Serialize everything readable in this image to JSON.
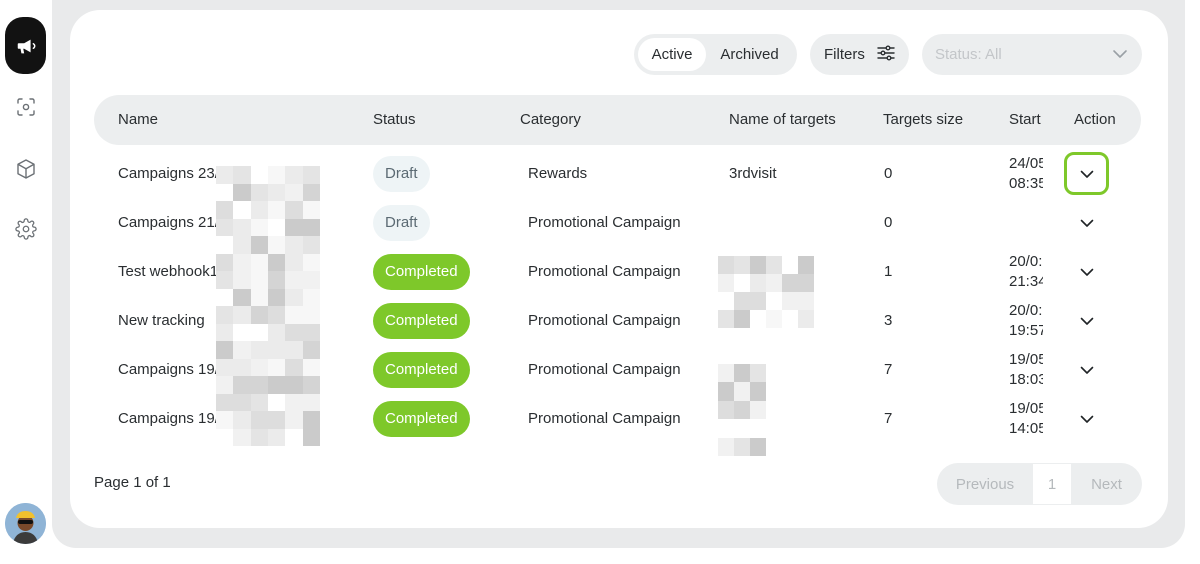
{
  "sidebar": {
    "items": [
      {
        "icon": "megaphone-icon",
        "active": true
      },
      {
        "icon": "scan-icon",
        "active": false
      },
      {
        "icon": "box-icon",
        "active": false
      },
      {
        "icon": "gear-icon",
        "active": false
      }
    ]
  },
  "toolbar": {
    "tab_active": "Active",
    "tab_archived": "Archived",
    "filters_label": "Filters",
    "status_placeholder": "Status: All"
  },
  "table": {
    "headers": {
      "name": "Name",
      "status": "Status",
      "category": "Category",
      "targets_name": "Name of targets",
      "targets_size": "Targets size",
      "start": "Start",
      "action": "Action"
    },
    "rows": [
      {
        "name": "Campaigns 23/",
        "status": "Draft",
        "category": "Rewards",
        "targets_name": "3rdvisit",
        "targets_size": "0",
        "start_date": "24/05",
        "start_time": "08:35"
      },
      {
        "name": "Campaigns 21/(",
        "status": "Draft",
        "category": "Promotional Campaign",
        "targets_name": "",
        "targets_size": "0",
        "start_date": "",
        "start_time": ""
      },
      {
        "name": "Test webhook1",
        "status": "Completed",
        "category": "Promotional Campaign",
        "targets_name": "",
        "targets_size": "1",
        "start_date": "20/0:",
        "start_time": "21:34"
      },
      {
        "name": "New tracking",
        "status": "Completed",
        "category": "Promotional Campaign",
        "targets_name": "",
        "targets_size": "3",
        "start_date": "20/0:",
        "start_time": "19:57"
      },
      {
        "name": "Campaigns 19/",
        "status": "Completed",
        "category": "Promotional Campaign",
        "targets_name": "",
        "targets_size": "7",
        "start_date": "19/05",
        "start_time": "18:03"
      },
      {
        "name": "Campaigns 19/",
        "status": "Completed",
        "category": "Promotional Campaign",
        "targets_name": "",
        "targets_size": "7",
        "start_date": "19/05",
        "start_time": "14:05"
      }
    ]
  },
  "footer": {
    "page_info": "Page 1 of 1",
    "prev_label": "Previous",
    "current_page": "1",
    "next_label": "Next"
  },
  "colors": {
    "accent_green": "#7ec82a",
    "panel_gray": "#e9eaeb",
    "active_nav": "#121212"
  }
}
